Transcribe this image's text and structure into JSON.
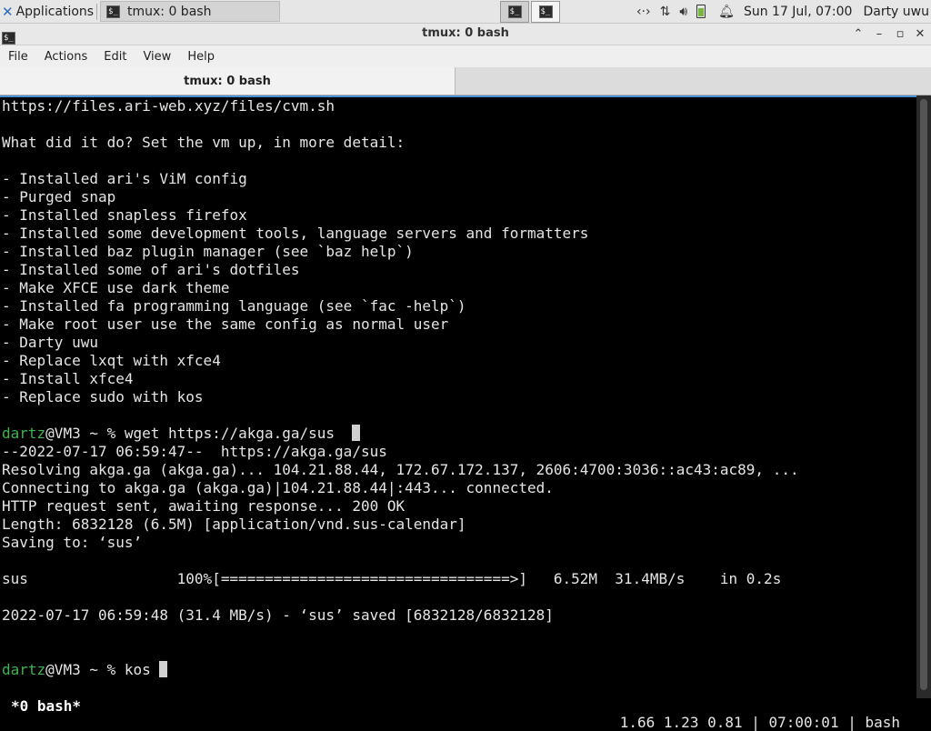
{
  "panel": {
    "applications_label": "Applications",
    "task_title": "tmux: 0 bash",
    "datetime": "Sun 17 Jul, 07:00",
    "username": "Darty uwu",
    "icons": [
      "network-icon",
      "updown-icon",
      "volume-icon",
      "battery-icon",
      "bell-icon"
    ]
  },
  "window": {
    "title": "tmux: 0 bash",
    "menu": [
      "File",
      "Actions",
      "Edit",
      "View",
      "Help"
    ],
    "tab_label": "tmux: 0 bash"
  },
  "terminal": {
    "lines": [
      {
        "text": "https://files.ari-web.xyz/files/cvm.sh"
      },
      {
        "text": ""
      },
      {
        "text": "What did it do? Set the vm up, in more detail:"
      },
      {
        "text": ""
      },
      {
        "text": "- Installed ari's ViM config"
      },
      {
        "text": "- Purged snap"
      },
      {
        "text": "- Installed snapless firefox"
      },
      {
        "text": "- Installed some development tools, language servers and formatters"
      },
      {
        "text": "- Installed baz plugin manager (see `baz help`)"
      },
      {
        "text": "- Installed some of ari's dotfiles"
      },
      {
        "text": "- Make XFCE use dark theme"
      },
      {
        "text": "- Installed fa programming language (see `fac -help`)"
      },
      {
        "text": "- Make root user use the same config as normal user"
      },
      {
        "text": "- Darty uwu"
      },
      {
        "text": "- Replace lxqt with xfce4"
      },
      {
        "text": "- Install xfce4"
      },
      {
        "text": "- Replace sudo with kos"
      },
      {
        "text": ""
      },
      {
        "user": "dartz",
        "rest": "@VM3 ~ % wget https://akga.ga/sus  ",
        "cursor": true
      },
      {
        "text": "--2022-07-17 06:59:47--  https://akga.ga/sus"
      },
      {
        "text": "Resolving akga.ga (akga.ga)... 104.21.88.44, 172.67.172.137, 2606:4700:3036::ac43:ac89, ..."
      },
      {
        "text": "Connecting to akga.ga (akga.ga)|104.21.88.44|:443... connected."
      },
      {
        "text": "HTTP request sent, awaiting response... 200 OK"
      },
      {
        "text": "Length: 6832128 (6.5M) [application/vnd.sus-calendar]"
      },
      {
        "text": "Saving to: ‘sus’"
      },
      {
        "text": ""
      },
      {
        "text": "sus                 100%[=================================>]   6.52M  31.4MB/s    in 0.2s"
      },
      {
        "text": ""
      },
      {
        "text": "2022-07-17 06:59:48 (31.4 MB/s) - ‘sus’ saved [6832128/6832128]"
      },
      {
        "text": ""
      },
      {
        "text": ""
      },
      {
        "user": "dartz",
        "rest": "@VM3 ~ % kos ",
        "cursor": true
      }
    ]
  },
  "tmux_status": {
    "window": "*0 bash*",
    "right": "1.66 1.23 0.81 | 07:00:01 | bash"
  }
}
